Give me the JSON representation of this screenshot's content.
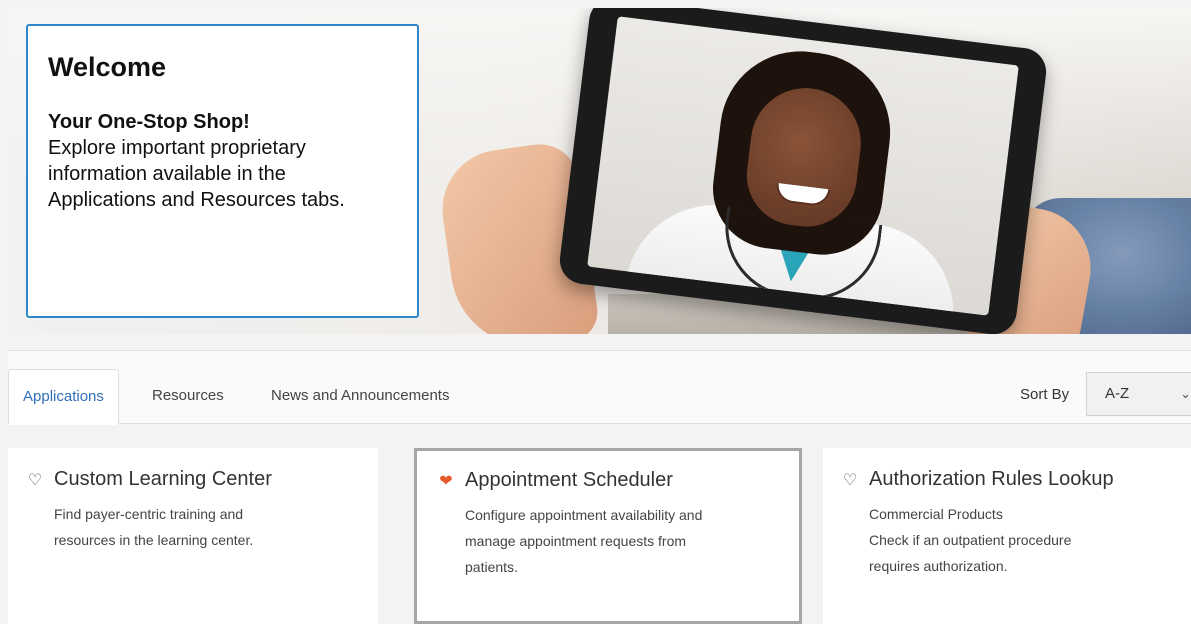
{
  "welcome": {
    "title": "Welcome",
    "subtitle": "Your One-Stop Shop!",
    "body": "Explore important proprietary information available in the Applications and Resources tabs."
  },
  "tabs": [
    {
      "label": "Applications",
      "active": true
    },
    {
      "label": "Resources",
      "active": false
    },
    {
      "label": "News and Announcements",
      "active": false
    }
  ],
  "sort": {
    "label": "Sort By",
    "value": "A-Z"
  },
  "cards": [
    {
      "title": "Custom Learning Center",
      "favorite": false,
      "lines": [
        "Find payer-centric training and",
        "resources in the learning center."
      ]
    },
    {
      "title": "Appointment Scheduler",
      "favorite": true,
      "lines": [
        "Configure appointment availability and",
        "manage appointment requests from",
        "patients."
      ]
    },
    {
      "title": "Authorization Rules Lookup",
      "favorite": false,
      "lines": [
        "Commercial Products",
        "Check if an outpatient procedure",
        "requires authorization."
      ]
    }
  ],
  "icons": {
    "favorite_off": "heart-outline-icon",
    "favorite_on": "heart-filled-icon",
    "sort_chevron": "chevron-down-icon"
  },
  "colors": {
    "accent": "#2f6fb7",
    "card_border": "#2f86c8",
    "favorite": "#e55a2b"
  }
}
